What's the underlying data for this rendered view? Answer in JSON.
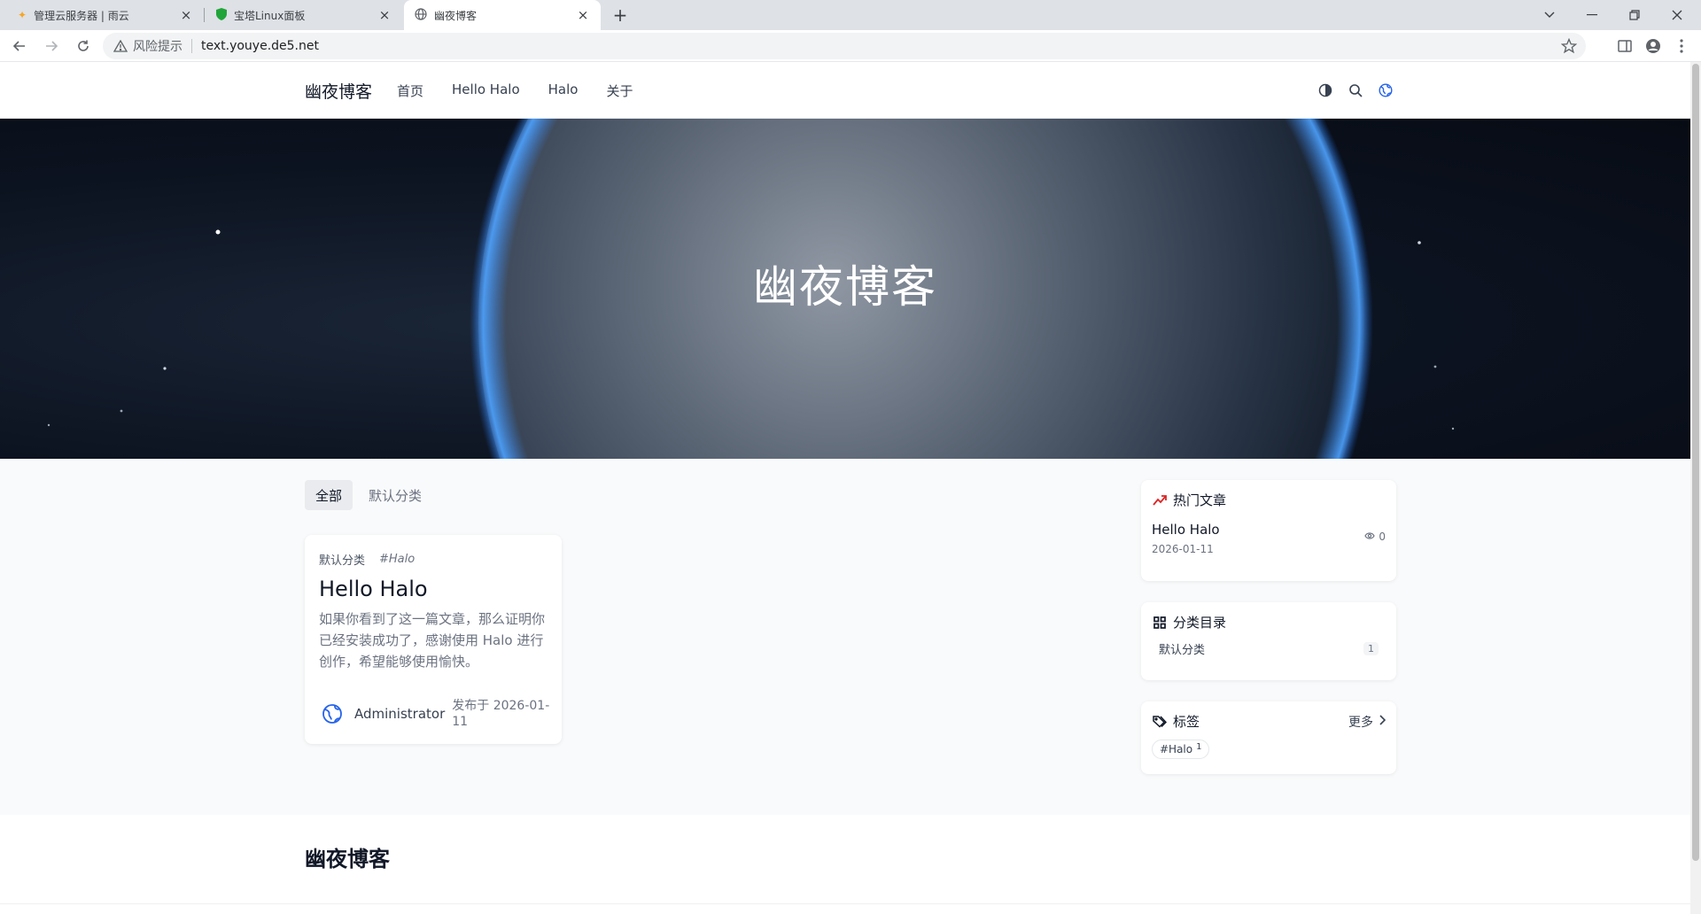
{
  "browser": {
    "tabs": [
      {
        "title": "管理云服务器 | 雨云",
        "icon": "rain-cloud-favicon"
      },
      {
        "title": "宝塔Linux面板",
        "icon": "shield-favicon"
      },
      {
        "title": "幽夜博客",
        "icon": "globe-favicon",
        "active": true
      }
    ],
    "address": {
      "risk_label": "风险提示",
      "url": "text.youye.de5.net"
    }
  },
  "site": {
    "logo": "幽夜博客",
    "nav": [
      "首页",
      "Hello Halo",
      "Halo",
      "关于"
    ],
    "hero_title": "幽夜博客"
  },
  "categories_tabs": [
    "全部",
    "默认分类"
  ],
  "post": {
    "category": "默认分类",
    "tag": "#Halo",
    "title": "Hello Halo",
    "excerpt": "如果你看到了这一篇文章，那么证明你已经安装成功了，感谢使用 Halo 进行创作，希望能够使用愉快。",
    "author": "Administrator",
    "published": "发布于 2026-01-11"
  },
  "sidebar": {
    "hot": {
      "title": "热门文章",
      "item_title": "Hello Halo",
      "item_date": "2026-01-11",
      "views": "0"
    },
    "categories": {
      "title": "分类目录",
      "item_name": "默认分类",
      "item_count": "1"
    },
    "tags": {
      "title": "标签",
      "more": "更多",
      "tag_name": "#Halo",
      "tag_count": "1"
    }
  },
  "footer": {
    "title": "幽夜博客"
  },
  "colors": {
    "accent": "#2563eb",
    "hot_icon": "#dc2626",
    "hero_bg": "#0c1320"
  }
}
